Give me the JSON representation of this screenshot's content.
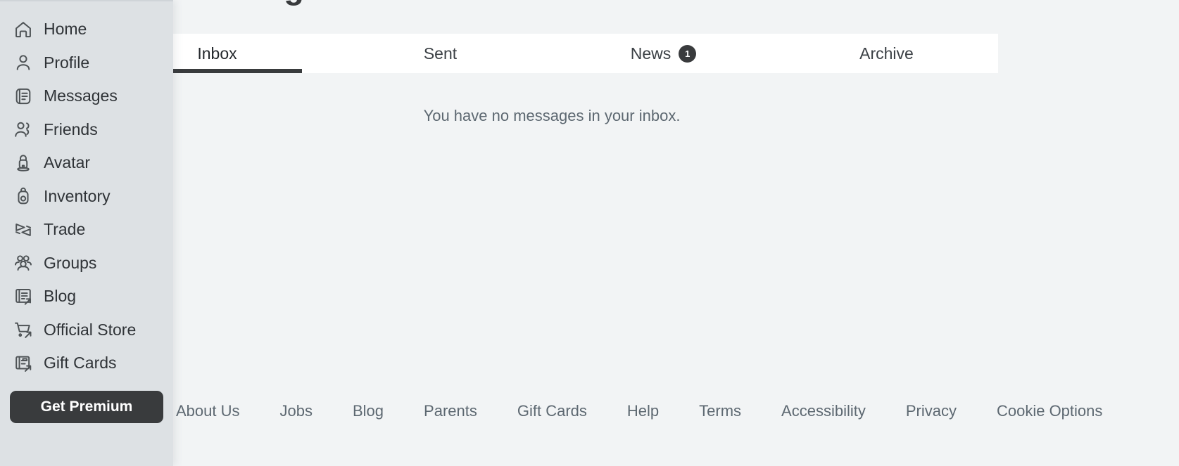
{
  "page": {
    "title": "Messages",
    "background_color": "#f2f4f5"
  },
  "tabs": {
    "items": [
      {
        "label": "Inbox",
        "badge": "",
        "active": true
      },
      {
        "label": "Sent",
        "badge": "",
        "active": false
      },
      {
        "label": "News",
        "badge": "1",
        "active": false
      },
      {
        "label": "Archive",
        "badge": "",
        "active": false
      }
    ],
    "active_indicator_color": "#393b3d",
    "background_color": "#ffffff"
  },
  "inbox": {
    "empty_message": "You have no messages in your inbox."
  },
  "sidebar": {
    "background_color": "#dde1e4",
    "items": [
      {
        "label": "Home",
        "icon": "home-icon"
      },
      {
        "label": "Profile",
        "icon": "person-icon"
      },
      {
        "label": "Messages",
        "icon": "message-document-icon"
      },
      {
        "label": "Friends",
        "icon": "friends-icon"
      },
      {
        "label": "Avatar",
        "icon": "avatar-icon"
      },
      {
        "label": "Inventory",
        "icon": "backpack-icon"
      },
      {
        "label": "Trade",
        "icon": "trade-arrows-icon"
      },
      {
        "label": "Groups",
        "icon": "groups-icon"
      },
      {
        "label": "Blog",
        "icon": "blog-external-icon"
      },
      {
        "label": "Official Store",
        "icon": "shopping-cart-external-icon"
      },
      {
        "label": "Gift Cards",
        "icon": "gift-card-external-icon"
      }
    ],
    "premium_button": {
      "label": "Get Premium",
      "background_color": "#393b3d",
      "text_color": "#ffffff"
    }
  },
  "footer": {
    "links": [
      "About Us",
      "Jobs",
      "Blog",
      "Parents",
      "Gift Cards",
      "Help",
      "Terms",
      "Accessibility",
      "Privacy",
      "Cookie Options"
    ],
    "text_color": "#5d6871"
  }
}
